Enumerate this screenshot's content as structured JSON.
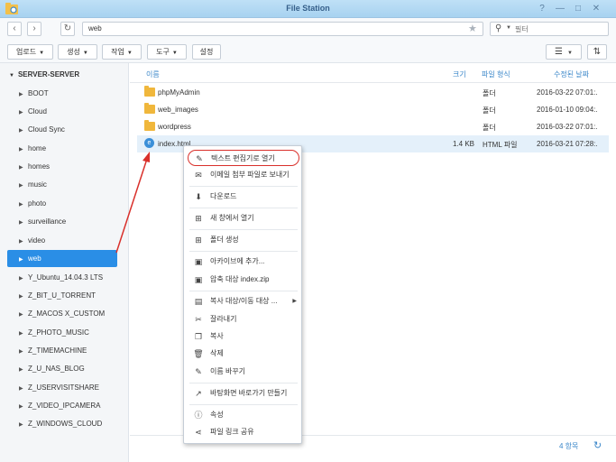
{
  "window": {
    "title": "File Station",
    "buttons": [
      "?",
      "—",
      "□",
      "✕"
    ]
  },
  "navigation": {
    "back": "‹",
    "forward": "›",
    "refresh": "↻",
    "path": "web",
    "filter_placeholder": "필터"
  },
  "toolbar": {
    "upload": "업로드",
    "create": "생성",
    "action": "작업",
    "tools": "도구",
    "settings": "설정"
  },
  "sidebar": {
    "root": "SERVER-SERVER",
    "items": [
      "BOOT",
      "Cloud",
      "Cloud Sync",
      "home",
      "homes",
      "music",
      "photo",
      "surveillance",
      "video",
      "web",
      "Y_Ubuntu_14.04.3 LTS",
      "Z_BIT_U_TORRENT",
      "Z_MACOS X_CUSTOM",
      "Z_PHOTO_MUSIC",
      "Z_TIMEMACHINE",
      "Z_U_NAS_BLOG",
      "Z_USERVISITSHARE",
      "Z_VIDEO_IPCAMERA",
      "Z_WINDOWS_CLOUD"
    ],
    "selected": "web"
  },
  "columns": {
    "name": "이름",
    "size": "크기",
    "type": "파일 형식",
    "modified": "수정된 날짜"
  },
  "files": [
    {
      "name": "phpMyAdmin",
      "size": "",
      "type": "폴더",
      "modified": "2016-03-22 07:01:.",
      "kind": "folder"
    },
    {
      "name": "web_images",
      "size": "",
      "type": "폴더",
      "modified": "2016-01-10 09:04:.",
      "kind": "folder"
    },
    {
      "name": "wordpress",
      "size": "",
      "type": "폴더",
      "modified": "2016-03-22 07:01:.",
      "kind": "folder"
    },
    {
      "name": "index.html",
      "size": "1.4 KB",
      "type": "HTML 파일",
      "modified": "2016-03-21 07:28:.",
      "kind": "html"
    }
  ],
  "context_menu": [
    {
      "label": "텍스트 편집기로 열기",
      "icon": "text-editor-icon",
      "glyph": "✎"
    },
    {
      "label": "이메일 첨부 파일로 보내기",
      "icon": "email-icon",
      "glyph": "✉"
    },
    {
      "label": "다운로드",
      "icon": "download-icon",
      "glyph": "⬇"
    },
    {
      "label": "새 창에서 열기",
      "icon": "new-window-icon",
      "glyph": "⊞"
    },
    {
      "label": "폴더 생성",
      "icon": "new-folder-icon",
      "glyph": "⊞"
    },
    {
      "label": "아카이브에 추가...",
      "icon": "archive-icon",
      "glyph": "▣"
    },
    {
      "label": "압축 대상 index.zip",
      "icon": "compress-icon",
      "glyph": "▣"
    },
    {
      "label": "복사 대상/이동 대상 ...",
      "icon": "copy-move-icon",
      "glyph": "▤"
    },
    {
      "label": "잘라내기",
      "icon": "cut-icon",
      "glyph": "✂"
    },
    {
      "label": "복사",
      "icon": "copy-icon",
      "glyph": "❐"
    },
    {
      "label": "삭제",
      "icon": "delete-icon",
      "glyph": "🗑"
    },
    {
      "label": "이름 바꾸기",
      "icon": "rename-icon",
      "glyph": "✎"
    },
    {
      "label": "바탕화면 바로가기 만들기",
      "icon": "shortcut-icon",
      "glyph": "↗"
    },
    {
      "label": "속성",
      "icon": "info-icon",
      "glyph": "ⓘ"
    },
    {
      "label": "파일 링크 공유",
      "icon": "share-icon",
      "glyph": "⋖"
    }
  ],
  "status": {
    "item_count": "4 항목"
  },
  "colors": {
    "accent": "#2a8ee6",
    "annotation": "#d9302b",
    "folder": "#f0b73c"
  }
}
